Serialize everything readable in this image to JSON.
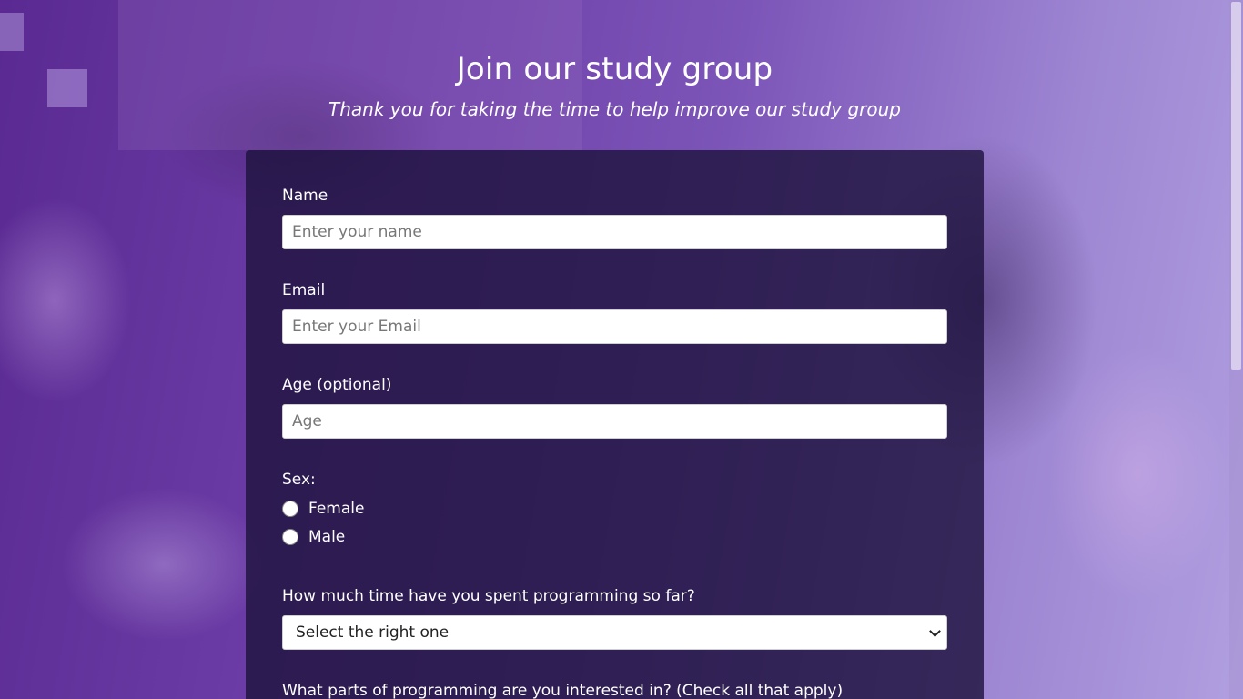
{
  "header": {
    "title": "Join our study group",
    "subtitle": "Thank you for taking the time to help improve our study group"
  },
  "form": {
    "name": {
      "label": "Name",
      "placeholder": "Enter your name",
      "value": ""
    },
    "email": {
      "label": "Email",
      "placeholder": "Enter your Email",
      "value": ""
    },
    "age": {
      "label": "Age (optional)",
      "placeholder": "Age",
      "value": ""
    },
    "sex": {
      "label": "Sex:",
      "options": [
        {
          "label": "Female",
          "checked": false
        },
        {
          "label": "Male",
          "checked": false
        }
      ]
    },
    "experience": {
      "label": "How much time have you spent programming so far?",
      "selected": "Select the right one"
    },
    "interests": {
      "label": "What parts of programming are you interested in? (Check all that apply)"
    }
  },
  "colors": {
    "panel": "#1e143e",
    "background_accent": "#6a3fa8",
    "text": "#ffffff"
  }
}
